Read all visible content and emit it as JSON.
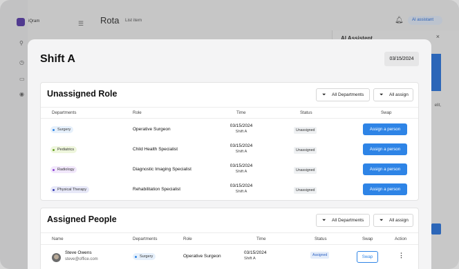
{
  "app": {
    "logo_text": "iQram",
    "page_title": "Rota",
    "list_tab": "List item",
    "ai_button": "AI assistant"
  },
  "ai_panel": {
    "title": "AI Assistent",
    "text_1": "elit,",
    "text_2": "X",
    "text_3": "X"
  },
  "modal": {
    "title": "Shift A",
    "date": "03/15/2024"
  },
  "unassigned": {
    "title": "Unassigned Role",
    "filter_departments": "All Departments",
    "filter_assign": "All assign",
    "headers": {
      "departments": "Departments",
      "role": "Role",
      "time": "Time",
      "status": "Status",
      "swap": "Swap"
    },
    "rows": [
      {
        "department": "Surgery",
        "dept_color": "#2e84e6",
        "dept_bg": "#e6f0fb",
        "role": "Operative Surgeon",
        "date": "03/15/2024",
        "shift": "Shift A",
        "status": "Unassigned",
        "action": "Assign a person"
      },
      {
        "department": "Pediatrics",
        "dept_color": "#6aa629",
        "dept_bg": "#eef6dc",
        "role": "Child Health Specialist",
        "date": "03/15/2024",
        "shift": "Shift A",
        "status": "Unassigned",
        "action": "Assign a person"
      },
      {
        "department": "Radiology",
        "dept_color": "#8e44d6",
        "dept_bg": "#f1e7fb",
        "role": "Diagnostic Imaging Specialist",
        "date": "03/15/2024",
        "shift": "Shift A",
        "status": "Unassigned",
        "action": "Assign a person"
      },
      {
        "department": "Physical Therapy",
        "dept_color": "#3b3fb5",
        "dept_bg": "#e7e8f8",
        "role": "Rehabilitation Specialist",
        "date": "03/15/2024",
        "shift": "Shift A",
        "status": "Unassigned",
        "action": "Assign a person"
      }
    ]
  },
  "assigned": {
    "title": "Assigned  People",
    "filter_departments": "All Departments",
    "filter_assign": "All assign",
    "headers": {
      "name": "Name",
      "departments": "Departments",
      "role": "Role",
      "time": "Time",
      "status": "Status",
      "swap": "Swap",
      "action": "Action"
    },
    "rows": [
      {
        "name": "Steve Owens",
        "email": "steve@office.com",
        "department": "Surgery",
        "dept_color": "#2e84e6",
        "dept_bg": "#e6f0fb",
        "role": "Operative Surgeon",
        "date": "03/15/2024",
        "shift": "Shift A",
        "status": "Assigned",
        "swap": "Swap",
        "action_icon": "more-vertical-icon"
      }
    ]
  }
}
